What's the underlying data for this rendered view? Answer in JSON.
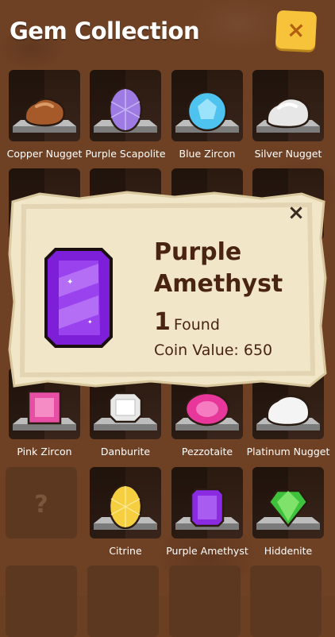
{
  "header": {
    "title": "Gem Collection",
    "close_label": "×"
  },
  "grid": {
    "row1": [
      "Copper Nugget",
      "Purple Scapolite",
      "Blue Zircon",
      "Silver Nugget"
    ],
    "row4": [
      "Pink Zircon",
      "Danburite",
      "Pezzotaite",
      "Platinum Nugget"
    ],
    "row5": [
      "?",
      "Citrine",
      "Purple Amethyst",
      "Hiddenite"
    ]
  },
  "popup": {
    "close_label": "×",
    "name_line1": "Purple",
    "name_line2": "Amethyst",
    "found_count": "1",
    "found_text": "Found",
    "coin_value_text": "Coin Value: 650"
  },
  "colors": {
    "background": "#6e4024",
    "accent": "#f6c33b",
    "parchment": "#f2e6c8",
    "popup_text": "#4a2412"
  }
}
